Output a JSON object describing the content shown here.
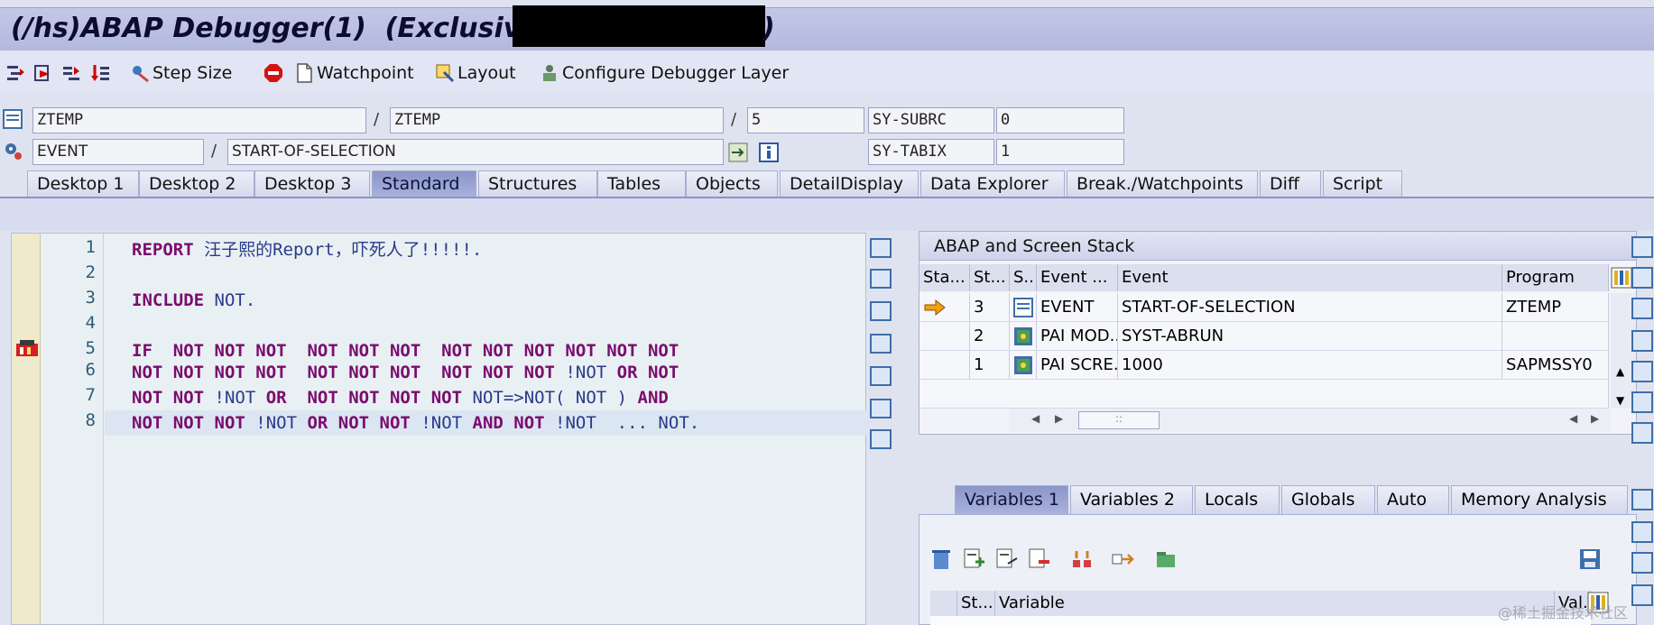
{
  "window": {
    "title": "(/hs)ABAP Debugger(1)  (Exclusive)",
    "title_suffix": ")"
  },
  "toolbar": {
    "step_size": "Step Size",
    "watchpoint": "Watchpoint",
    "layout": "Layout",
    "configure_layer": "Configure Debugger Layer"
  },
  "info": {
    "program": "ZTEMP",
    "include": "ZTEMP",
    "line": "5",
    "subrc_label": "SY-SUBRC",
    "subrc_value": "0",
    "event_type": "EVENT",
    "event_name": "START-OF-SELECTION",
    "tabix_label": "SY-TABIX",
    "tabix_value": "1",
    "sep": "/"
  },
  "tabs": [
    "Desktop 1",
    "Desktop 2",
    "Desktop 3",
    "Standard",
    "Structures",
    "Tables",
    "Objects",
    "DetailDisplay",
    "Data Explorer",
    "Break./Watchpoints",
    "Diff",
    "Script"
  ],
  "active_tab": "Standard",
  "editor": {
    "line_numbers": [
      "1",
      "2",
      "3",
      "4",
      "5",
      "6",
      "7",
      "8"
    ],
    "l1_kw": "REPORT",
    "l1_id": "汪子熙的Report，吓死人了!!!!!.",
    "l3_kw": "INCLUDE",
    "l3_id": "NOT.",
    "l5": "IF  NOT NOT NOT  NOT NOT NOT  NOT NOT NOT NOT NOT NOT",
    "l6a": "NOT NOT NOT NOT  NOT NOT NOT  NOT NOT NOT ",
    "l6b": "!NOT",
    "l6c": " OR NOT",
    "l7a": "NOT NOT ",
    "l7b": "!NOT",
    "l7c": " OR  NOT NOT NOT NOT ",
    "l7d": "NOT=>NOT( NOT )",
    "l7e": " AND",
    "l8a": "NOT NOT NOT ",
    "l8b": "!NOT",
    "l8c": " OR NOT NOT ",
    "l8d": "!NOT",
    "l8e": " AND NOT ",
    "l8f": "!NOT  ... NOT."
  },
  "stack": {
    "title": "ABAP and Screen Stack",
    "headers": [
      "Sta...",
      "St...",
      "S..",
      "Event ...",
      "Event",
      "Program"
    ],
    "rows": [
      {
        "level": "3",
        "type": "EVENT",
        "event": "START-OF-SELECTION",
        "program": "ZTEMP"
      },
      {
        "level": "2",
        "type": "PAI MOD...",
        "event": "SYST-ABRUN",
        "program": ""
      },
      {
        "level": "1",
        "type": "PAI SCRE...",
        "event": "1000",
        "program": "SAPMSSY0"
      }
    ],
    "scroll_grip": "::"
  },
  "variables": {
    "tabs": [
      "Variables 1",
      "Variables 2",
      "Locals",
      "Globals",
      "Auto",
      "Memory Analysis"
    ],
    "active_tab": "Variables 1",
    "headers": [
      "St...",
      "Variable",
      "Val."
    ]
  },
  "watermark": "@稀土掘金技术社区",
  "colors": {
    "keyword": "#7b0c6e",
    "identifier": "#2a3a8a",
    "active_tab": "#8a95c9",
    "title_bar": "#b3b8de"
  }
}
